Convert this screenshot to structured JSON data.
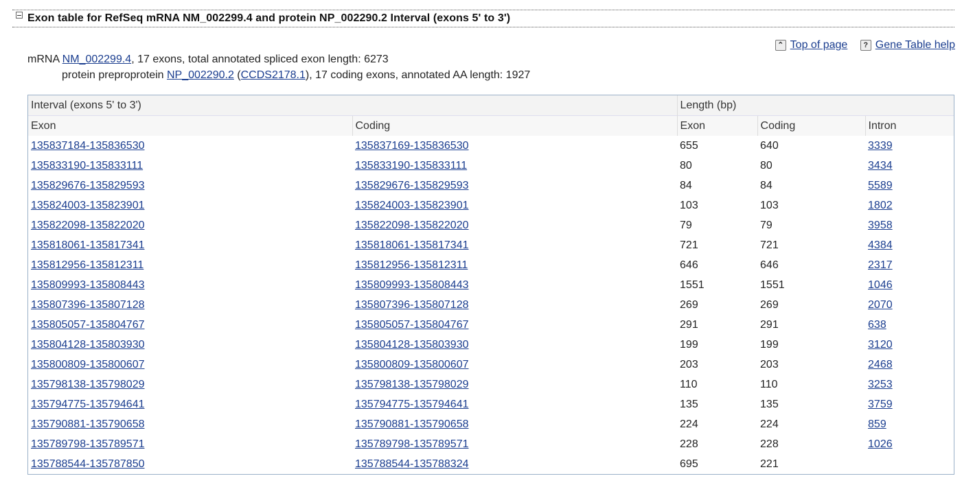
{
  "section": {
    "title": "Exon table for RefSeq mRNA NM_002299.4 and protein NP_002290.2 Interval (exons 5' to 3')"
  },
  "links": {
    "top_of_page": "Top of page",
    "gene_table_help": "Gene Table help"
  },
  "summary": {
    "mrna_prefix": "mRNA ",
    "mrna_accession": "NM_002299.4",
    "mrna_suffix": ", 17 exons, total annotated spliced exon length: 6273",
    "protein_prefix": "protein preproprotein ",
    "protein_accession": "NP_002290.2",
    "open_paren": " (",
    "ccds": "CCDS2178.1",
    "protein_suffix": "), 17 coding exons, annotated AA length: 1927"
  },
  "table": {
    "group_interval": "Interval (exons 5' to 3')",
    "group_length": "Length (bp)",
    "col_exon": "Exon",
    "col_coding": "Coding",
    "col_len_exon": "Exon",
    "col_len_coding": "Coding",
    "col_intron": "Intron",
    "rows": [
      {
        "exon": "135837184-135836530",
        "coding": "135837169-135836530",
        "len_exon": "655",
        "len_coding": "640",
        "intron": "3339"
      },
      {
        "exon": "135833190-135833111",
        "coding": "135833190-135833111",
        "len_exon": "80",
        "len_coding": "80",
        "intron": "3434"
      },
      {
        "exon": "135829676-135829593",
        "coding": "135829676-135829593",
        "len_exon": "84",
        "len_coding": "84",
        "intron": "5589"
      },
      {
        "exon": "135824003-135823901",
        "coding": "135824003-135823901",
        "len_exon": "103",
        "len_coding": "103",
        "intron": "1802"
      },
      {
        "exon": "135822098-135822020",
        "coding": "135822098-135822020",
        "len_exon": "79",
        "len_coding": "79",
        "intron": "3958"
      },
      {
        "exon": "135818061-135817341",
        "coding": "135818061-135817341",
        "len_exon": "721",
        "len_coding": "721",
        "intron": "4384"
      },
      {
        "exon": "135812956-135812311",
        "coding": "135812956-135812311",
        "len_exon": "646",
        "len_coding": "646",
        "intron": "2317"
      },
      {
        "exon": "135809993-135808443",
        "coding": "135809993-135808443",
        "len_exon": "1551",
        "len_coding": "1551",
        "intron": "1046"
      },
      {
        "exon": "135807396-135807128",
        "coding": "135807396-135807128",
        "len_exon": "269",
        "len_coding": "269",
        "intron": "2070"
      },
      {
        "exon": "135805057-135804767",
        "coding": "135805057-135804767",
        "len_exon": "291",
        "len_coding": "291",
        "intron": "638"
      },
      {
        "exon": "135804128-135803930",
        "coding": "135804128-135803930",
        "len_exon": "199",
        "len_coding": "199",
        "intron": "3120"
      },
      {
        "exon": "135800809-135800607",
        "coding": "135800809-135800607",
        "len_exon": "203",
        "len_coding": "203",
        "intron": "2468"
      },
      {
        "exon": "135798138-135798029",
        "coding": "135798138-135798029",
        "len_exon": "110",
        "len_coding": "110",
        "intron": "3253"
      },
      {
        "exon": "135794775-135794641",
        "coding": "135794775-135794641",
        "len_exon": "135",
        "len_coding": "135",
        "intron": "3759"
      },
      {
        "exon": "135790881-135790658",
        "coding": "135790881-135790658",
        "len_exon": "224",
        "len_coding": "224",
        "intron": "859"
      },
      {
        "exon": "135789798-135789571",
        "coding": "135789798-135789571",
        "len_exon": "228",
        "len_coding": "228",
        "intron": "1026"
      },
      {
        "exon": "135788544-135787850",
        "coding": "135788544-135788324",
        "len_exon": "695",
        "len_coding": "221",
        "intron": ""
      }
    ]
  }
}
